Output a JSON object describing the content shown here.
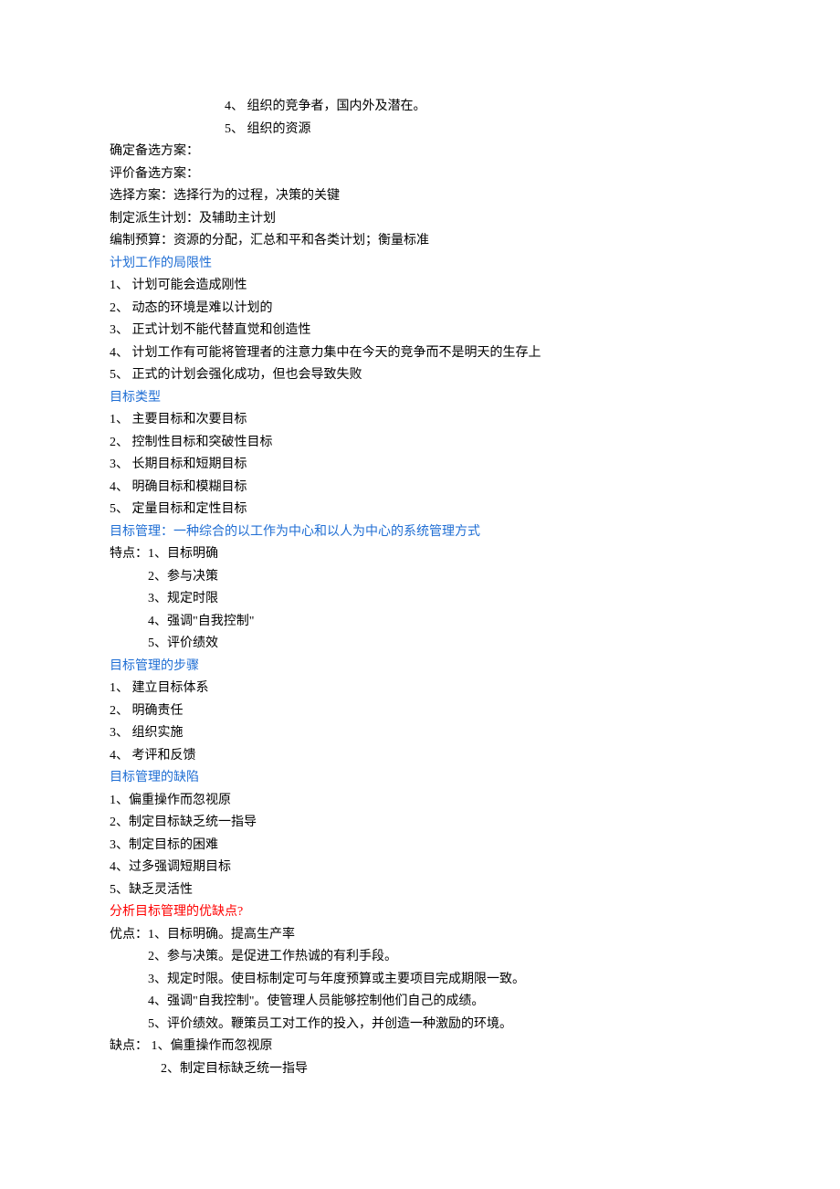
{
  "intro_indented": [
    "4、 组织的竞争者，国内外及潜在。",
    "5、 组织的资源"
  ],
  "intro_left": [
    "确定备选方案：",
    "评价备选方案：",
    "选择方案：选择行为的过程，决策的关键",
    "制定派生计划：及辅助主计划",
    "编制预算：资源的分配，汇总和平和各类计划；衡量标准"
  ],
  "section1": {
    "heading": "计划工作的局限性",
    "items": [
      "1、 计划可能会造成刚性",
      "2、 动态的环境是难以计划的",
      "3、 正式计划不能代替直觉和创造性",
      "4、 计划工作有可能将管理者的注意力集中在今天的竞争而不是明天的生存上",
      "5、 正式的计划会强化成功，但也会导致失败"
    ]
  },
  "section2": {
    "heading": "目标类型",
    "items": [
      "1、 主要目标和次要目标",
      "2、 控制性目标和突破性目标",
      "3、 长期目标和短期目标",
      "4、 明确目标和模糊目标",
      "5、 定量目标和定性目标"
    ]
  },
  "section3": {
    "heading": "目标管理：一种综合的以工作为中心和以人为中心的系统管理方式",
    "lead": "特点：1、目标明确",
    "sub": [
      "2、参与决策",
      "3、规定时限",
      "4、强调\"自我控制\"",
      "5、评价绩效"
    ]
  },
  "section4": {
    "heading": "目标管理的步骤",
    "items": [
      "1、 建立目标体系",
      "2、 明确责任",
      "3、 组织实施",
      "4、 考评和反馈"
    ]
  },
  "section5": {
    "heading": "目标管理的缺陷",
    "items": [
      "1、偏重操作而忽视原",
      "2、制定目标缺乏统一指导",
      "3、制定目标的困难",
      "4、过多强调短期目标",
      "5、缺乏灵活性"
    ]
  },
  "section6": {
    "heading": "分析目标管理的优缺点?",
    "adv_lead": "优点：1、目标明确。提高生产率",
    "adv_sub": [
      "2、参与决策。是促进工作热诚的有利手段。",
      "3、规定时限。使目标制定可与年度预算或主要项目完成期限一致。",
      "4、强调\"自我控制\"。使管理人员能够控制他们自己的成绩。",
      "5、评价绩效。鞭策员工对工作的投入，并创造一种激励的环境。"
    ],
    "dis_lead": "缺点： 1、偏重操作而忽视原",
    "dis_sub": [
      "2、制定目标缺乏统一指导"
    ]
  }
}
